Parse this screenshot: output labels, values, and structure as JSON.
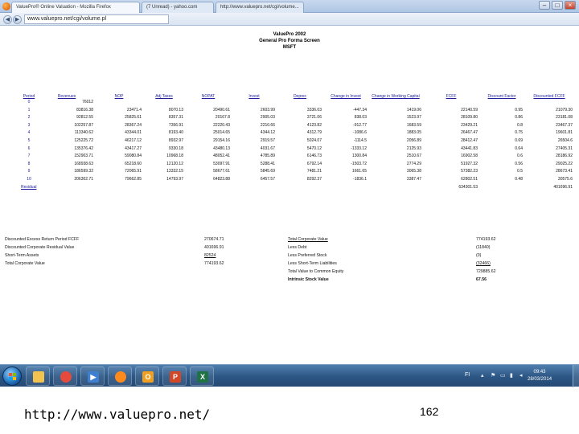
{
  "browser": {
    "window_title": "ValuePro® Online Valuation - Mozilla Firefox",
    "tabs": [
      {
        "label": "ValuePro® Online Valuation - Mozilla Firefox"
      },
      {
        "label": "(7 Unread) - yahoo.com"
      },
      {
        "label": "http://www.valuepro.net/cgi/volume..."
      }
    ],
    "url": "www.valuepro.net/cgi/volume.pl"
  },
  "report": {
    "title": "ValuePro 2002",
    "subtitle": "General Pro Forma Screen",
    "ticker": "MSFT",
    "columns": [
      "Period",
      "Revenues",
      "NOP",
      "Adj Taxes",
      "NOPAT",
      "Invest",
      "Deprec",
      "Change in Invest",
      "Change in Working Capital",
      "FCFF",
      "Discount Factor",
      "Discounted FCFF"
    ],
    "rows": [
      [
        "0",
        "76012",
        "",
        "",
        "",
        "",
        "",
        "",
        "",
        "",
        "",
        ""
      ],
      [
        "1",
        "83816.38",
        "23471.4",
        "8070.13",
        "20490.61",
        "2603.99",
        "3336.03",
        "-447.34",
        "1419.06",
        "22140.59",
        "0.95",
        "21079.30"
      ],
      [
        "2",
        "92812.55",
        "25825.61",
        "8357.31",
        "20167.8",
        "2905.03",
        "3721.06",
        "838.03",
        "1523.97",
        "28109.80",
        "0.86",
        "23181.08"
      ],
      [
        "3",
        "102257.87",
        "28367.24",
        "7356.91",
        "22220.43",
        "2210.66",
        "4123.82",
        "-912.77",
        "1683.59",
        "23429.21",
        "0.8",
        "23467.37"
      ],
      [
        "4",
        "113340.62",
        "43344.01",
        "8193.40",
        "25014.65",
        "4344.12",
        "4312.79",
        "-1086.6",
        "1883.05",
        "26467.47",
        "0.75",
        "19601.81"
      ],
      [
        "5",
        "125225.72",
        "46217.12",
        "8932.97",
        "29154.16",
        "2919.57",
        "5024.07",
        "-1114.5",
        "2056.89",
        "28412.47",
        "0.69",
        "26504.6"
      ],
      [
        "6",
        "135376.42",
        "43417.27",
        "9330.18",
        "43480.13",
        "4031.67",
        "5470.12",
        "-1333.12",
        "2125.93",
        "43441.83",
        "0.64",
        "27405.31"
      ],
      [
        "7",
        "152903.71",
        "59080.84",
        "10968.18",
        "48052.41",
        "4785.89",
        "6146.73",
        "1300.84",
        "2510.67",
        "16902.58",
        "0.6",
        "28186.92"
      ],
      [
        "8",
        "168938.63",
        "65218.60",
        "12120.12",
        "53097.91",
        "5288.41",
        "6792.14",
        "-1503.72",
        "2774.29",
        "51927.32",
        "0.56",
        "29025.22"
      ],
      [
        "9",
        "186599.32",
        "72065.91",
        "13332.15",
        "58677.61",
        "5845.69",
        "7481.21",
        "1661.65",
        "3065.38",
        "57382.23",
        "0.5",
        "28673.41"
      ],
      [
        "10",
        "206302.71",
        "79662.85",
        "14793.97",
        "64823.88",
        "6457.57",
        "8292.37",
        "-1836.1",
        "3387.47",
        "62802.51",
        "0.48",
        "30575.6"
      ],
      [
        "Residual",
        "",
        "",
        "",
        "",
        "",
        "",
        "",
        "",
        "634301.53",
        "",
        "401696.91"
      ]
    ],
    "summary_left": [
      {
        "label": "Discounted Excess Return Period FCFF",
        "value": "270674.71"
      },
      {
        "label": "Discounted Corporate Residual Value",
        "value": "401696.91"
      },
      {
        "label": "Short-Term Assets",
        "value": "82524"
      },
      {
        "label": "Total Corporate Value",
        "value": "774193.62"
      }
    ],
    "summary_right": [
      {
        "label": "Total Corporate Value",
        "value": "774193.62"
      },
      {
        "label": "Less Debt",
        "value": "(11840)"
      },
      {
        "label": "Less Preferred Stock",
        "value": "(0)"
      },
      {
        "label": "Less Short-Term Liabilities",
        "value": "(32466)"
      },
      {
        "label": "Total Value to Common Equity",
        "value": "729885.62"
      },
      {
        "label": "Intrinsic Stock Value",
        "value": "67.56"
      }
    ]
  },
  "taskbar": {
    "apps": [
      {
        "icon": "windows-explorer-icon",
        "color": "#f2c34f",
        "glyph": ""
      },
      {
        "icon": "chrome-icon",
        "color": "#e54b3c",
        "glyph": ""
      },
      {
        "icon": "media-player-icon",
        "color": "#3f7fd0",
        "glyph": "▶"
      },
      {
        "icon": "firefox-icon",
        "color": "#ff8a1c",
        "glyph": ""
      },
      {
        "icon": "outlook-icon",
        "color": "#f0a020",
        "glyph": "O"
      },
      {
        "icon": "powerpoint-icon",
        "color": "#d24726",
        "glyph": "P"
      },
      {
        "icon": "excel-icon",
        "color": "#1f7244",
        "glyph": "X"
      }
    ],
    "language": "FI",
    "time": "09:43",
    "date": "28/03/2014"
  },
  "slide": {
    "url": "http://www.valuepro.net/",
    "page_number": "162"
  }
}
